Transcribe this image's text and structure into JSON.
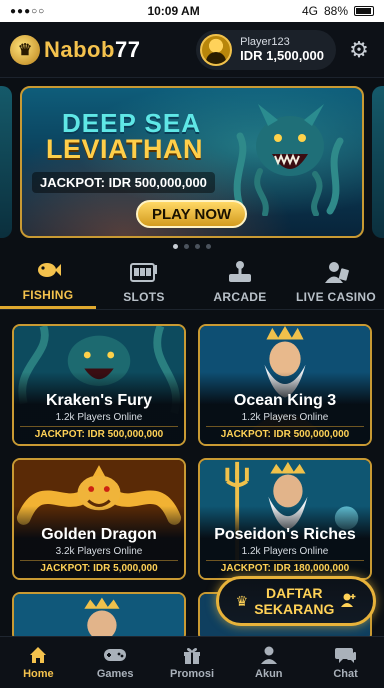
{
  "status_bar": {
    "signal": "●●●○○",
    "time": "10:09 AM",
    "network": "4G",
    "battery": "88%"
  },
  "header": {
    "brand_prefix": "Nabob",
    "brand_suffix": "77",
    "user": {
      "name": "Player123",
      "balance": "IDR 1,500,000"
    },
    "settings_icon": "gear-icon"
  },
  "banner": {
    "title_line1": "DEEP SEA",
    "title_line2": "LEVIATHAN",
    "jackpot": "JACKPOT: IDR 500,000,000",
    "cta": "PLAY NOW",
    "dots": [
      true,
      false,
      false,
      false
    ]
  },
  "categories": [
    {
      "label": "FISHING",
      "icon": "fish-icon",
      "active": true
    },
    {
      "label": "SLOTS",
      "icon": "slot-machine-icon",
      "active": false
    },
    {
      "label": "ARCADE",
      "icon": "joystick-icon",
      "active": false
    },
    {
      "label": "LIVE CASINO",
      "icon": "dealer-icon",
      "active": false
    }
  ],
  "games": [
    {
      "title": "Kraken's Fury",
      "players": "1.2k Players Online",
      "jackpot": "JACKPOT: IDR 500,000,000"
    },
    {
      "title": "Ocean King 3",
      "players": "1.2k Players Online",
      "jackpot": "JACKPOT: IDR 500,000,000"
    },
    {
      "title": "Golden Dragon",
      "players": "3.2k Players Online",
      "jackpot": "JACKPOT: IDR 5,000,000"
    },
    {
      "title": "Poseidon's Riches",
      "players": "1.2k Players Online",
      "jackpot": "JACKPOT: IDR 180,000,000"
    }
  ],
  "daftar": {
    "line1": "DAFTAR",
    "line2": "SEKARANG"
  },
  "nav": [
    {
      "label": "Home",
      "icon": "home-icon",
      "active": true
    },
    {
      "label": "Games",
      "icon": "gamepad-icon",
      "active": false
    },
    {
      "label": "Promosi",
      "icon": "gift-icon",
      "active": false
    },
    {
      "label": "Akun",
      "icon": "user-icon",
      "active": false
    },
    {
      "label": "Chat",
      "icon": "chat-icon",
      "active": false
    }
  ],
  "colors": {
    "gold": "#f4c24d",
    "bg": "#0b0f14",
    "card_border": "#c99a33"
  }
}
